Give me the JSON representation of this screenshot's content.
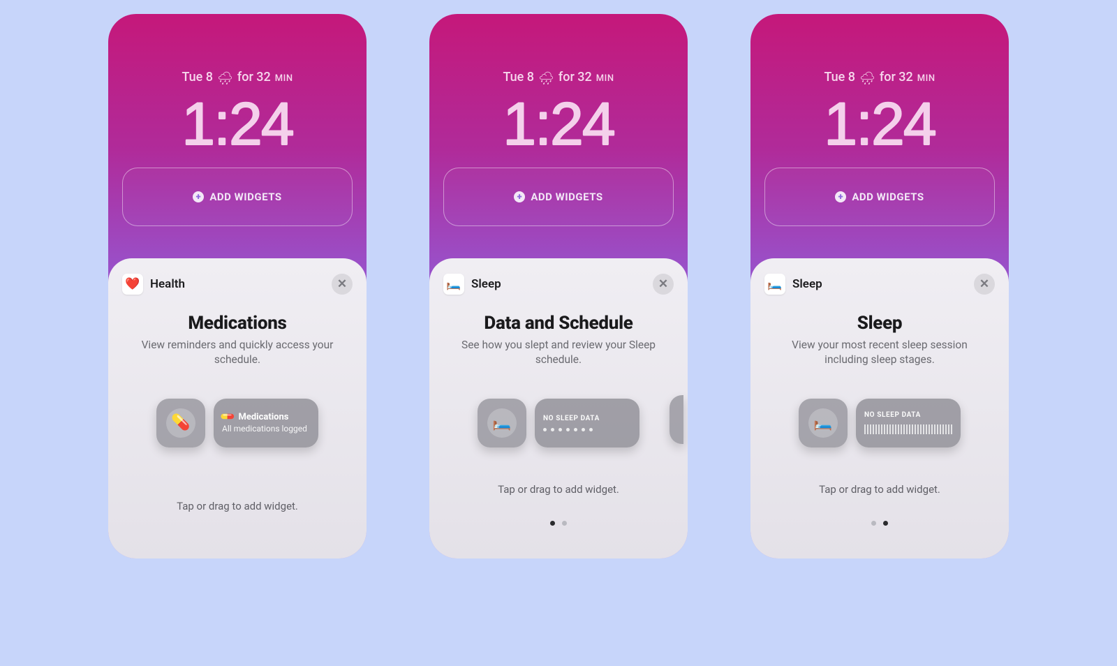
{
  "colors": {
    "page_bg": "#c7d5fa",
    "gradient_top": "#c5187a",
    "gradient_bottom": "#8e7cf0",
    "sheet_bg_top": "#f0eef3",
    "sheet_bg_bottom": "#e4e1e8",
    "widget_gray": "rgba(110,110,118,.58)"
  },
  "lockscreen": {
    "date": "Tue 8",
    "weather_icon": "rain-icon",
    "weather_glyph": "🌧",
    "weather_text": "for 32",
    "weather_unit": "MIN",
    "time": "1:24",
    "add_widgets_label": "ADD WIDGETS"
  },
  "screens": [
    {
      "app_icon_glyph": "❤️",
      "app_name": "Health",
      "title": "Medications",
      "subtitle": "View reminders and quickly access your schedule.",
      "widget_small_glyph": "💊",
      "widget_wide": {
        "kind": "medications",
        "icon_glyph": "💊",
        "heading": "Medications",
        "sub": "All medications logged"
      },
      "show_peek": false,
      "hint": "Tap or drag to add widget.",
      "pager": false
    },
    {
      "app_icon_glyph": "🛏️",
      "app_name": "Sleep",
      "title": "Data and Schedule",
      "subtitle": "See how you slept and review your Sleep schedule.",
      "widget_small_glyph": "🛏️",
      "widget_wide": {
        "kind": "sleep-dots",
        "label": "NO SLEEP DATA"
      },
      "show_peek": true,
      "hint": "Tap or drag to add widget.",
      "pager": true,
      "pager_active": 0
    },
    {
      "app_icon_glyph": "🛏️",
      "app_name": "Sleep",
      "title": "Sleep",
      "subtitle": "View your most recent sleep session including sleep stages.",
      "widget_small_glyph": "🛏️",
      "widget_wide": {
        "kind": "sleep-wave",
        "label": "NO SLEEP DATA"
      },
      "show_peek": false,
      "hint": "Tap or drag to add widget.",
      "pager": true,
      "pager_active": 1
    }
  ]
}
